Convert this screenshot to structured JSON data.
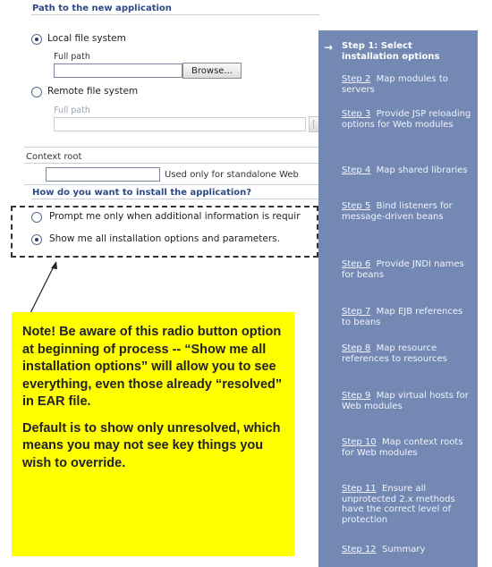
{
  "form": {
    "path_section_title": "Path to the new application",
    "local_option": "Local file system",
    "local_full_path_label": "Full path",
    "local_full_path_value": "",
    "browse_label": "Browse...",
    "remote_option": "Remote file system",
    "remote_full_path_label": "Full path",
    "remote_full_path_value": "",
    "remote_browse_partial": "[",
    "context_root_label": "Context root",
    "context_root_value": "",
    "context_root_hint": "Used only for standalone Web",
    "install_section_title": "How do you want to install the application?",
    "prompt_option": "Prompt me only when additional information is requir",
    "show_all_option": "Show me all installation options and parameters."
  },
  "note": {
    "paragraph1": "Note! Be aware of this radio button option at beginning of process -- “Show me all installation options” will allow you to see everything, even those already “resolved” in EAR file.",
    "paragraph2": "Default is to show only unresolved, which means you may not see key things you wish to override."
  },
  "steps": {
    "current_arrow": "→",
    "items": [
      {
        "link": "Step 1: Select installation options",
        "text": ""
      },
      {
        "link": "Step 2",
        "text": "Map modules to servers"
      },
      {
        "link": "Step 3",
        "text": "Provide JSP reloading options for Web modules"
      },
      {
        "link": "Step 4",
        "text": "Map shared libraries"
      },
      {
        "link": "Step 5",
        "text": "Bind listeners for message-driven beans"
      },
      {
        "link": "Step 6",
        "text": "Provide JNDI names for beans"
      },
      {
        "link": "Step 7",
        "text": "Map EJB references to beans"
      },
      {
        "link": "Step 8",
        "text": "Map resource references to resources"
      },
      {
        "link": "Step 9",
        "text": "Map virtual hosts for Web modules"
      },
      {
        "link": "Step 10",
        "text": "Map context roots for Web modules"
      },
      {
        "link": "Step 11",
        "text": "Ensure all unprotected 2.x methods have the correct level of protection"
      },
      {
        "link": "Step 12",
        "text": "Summary"
      }
    ]
  }
}
